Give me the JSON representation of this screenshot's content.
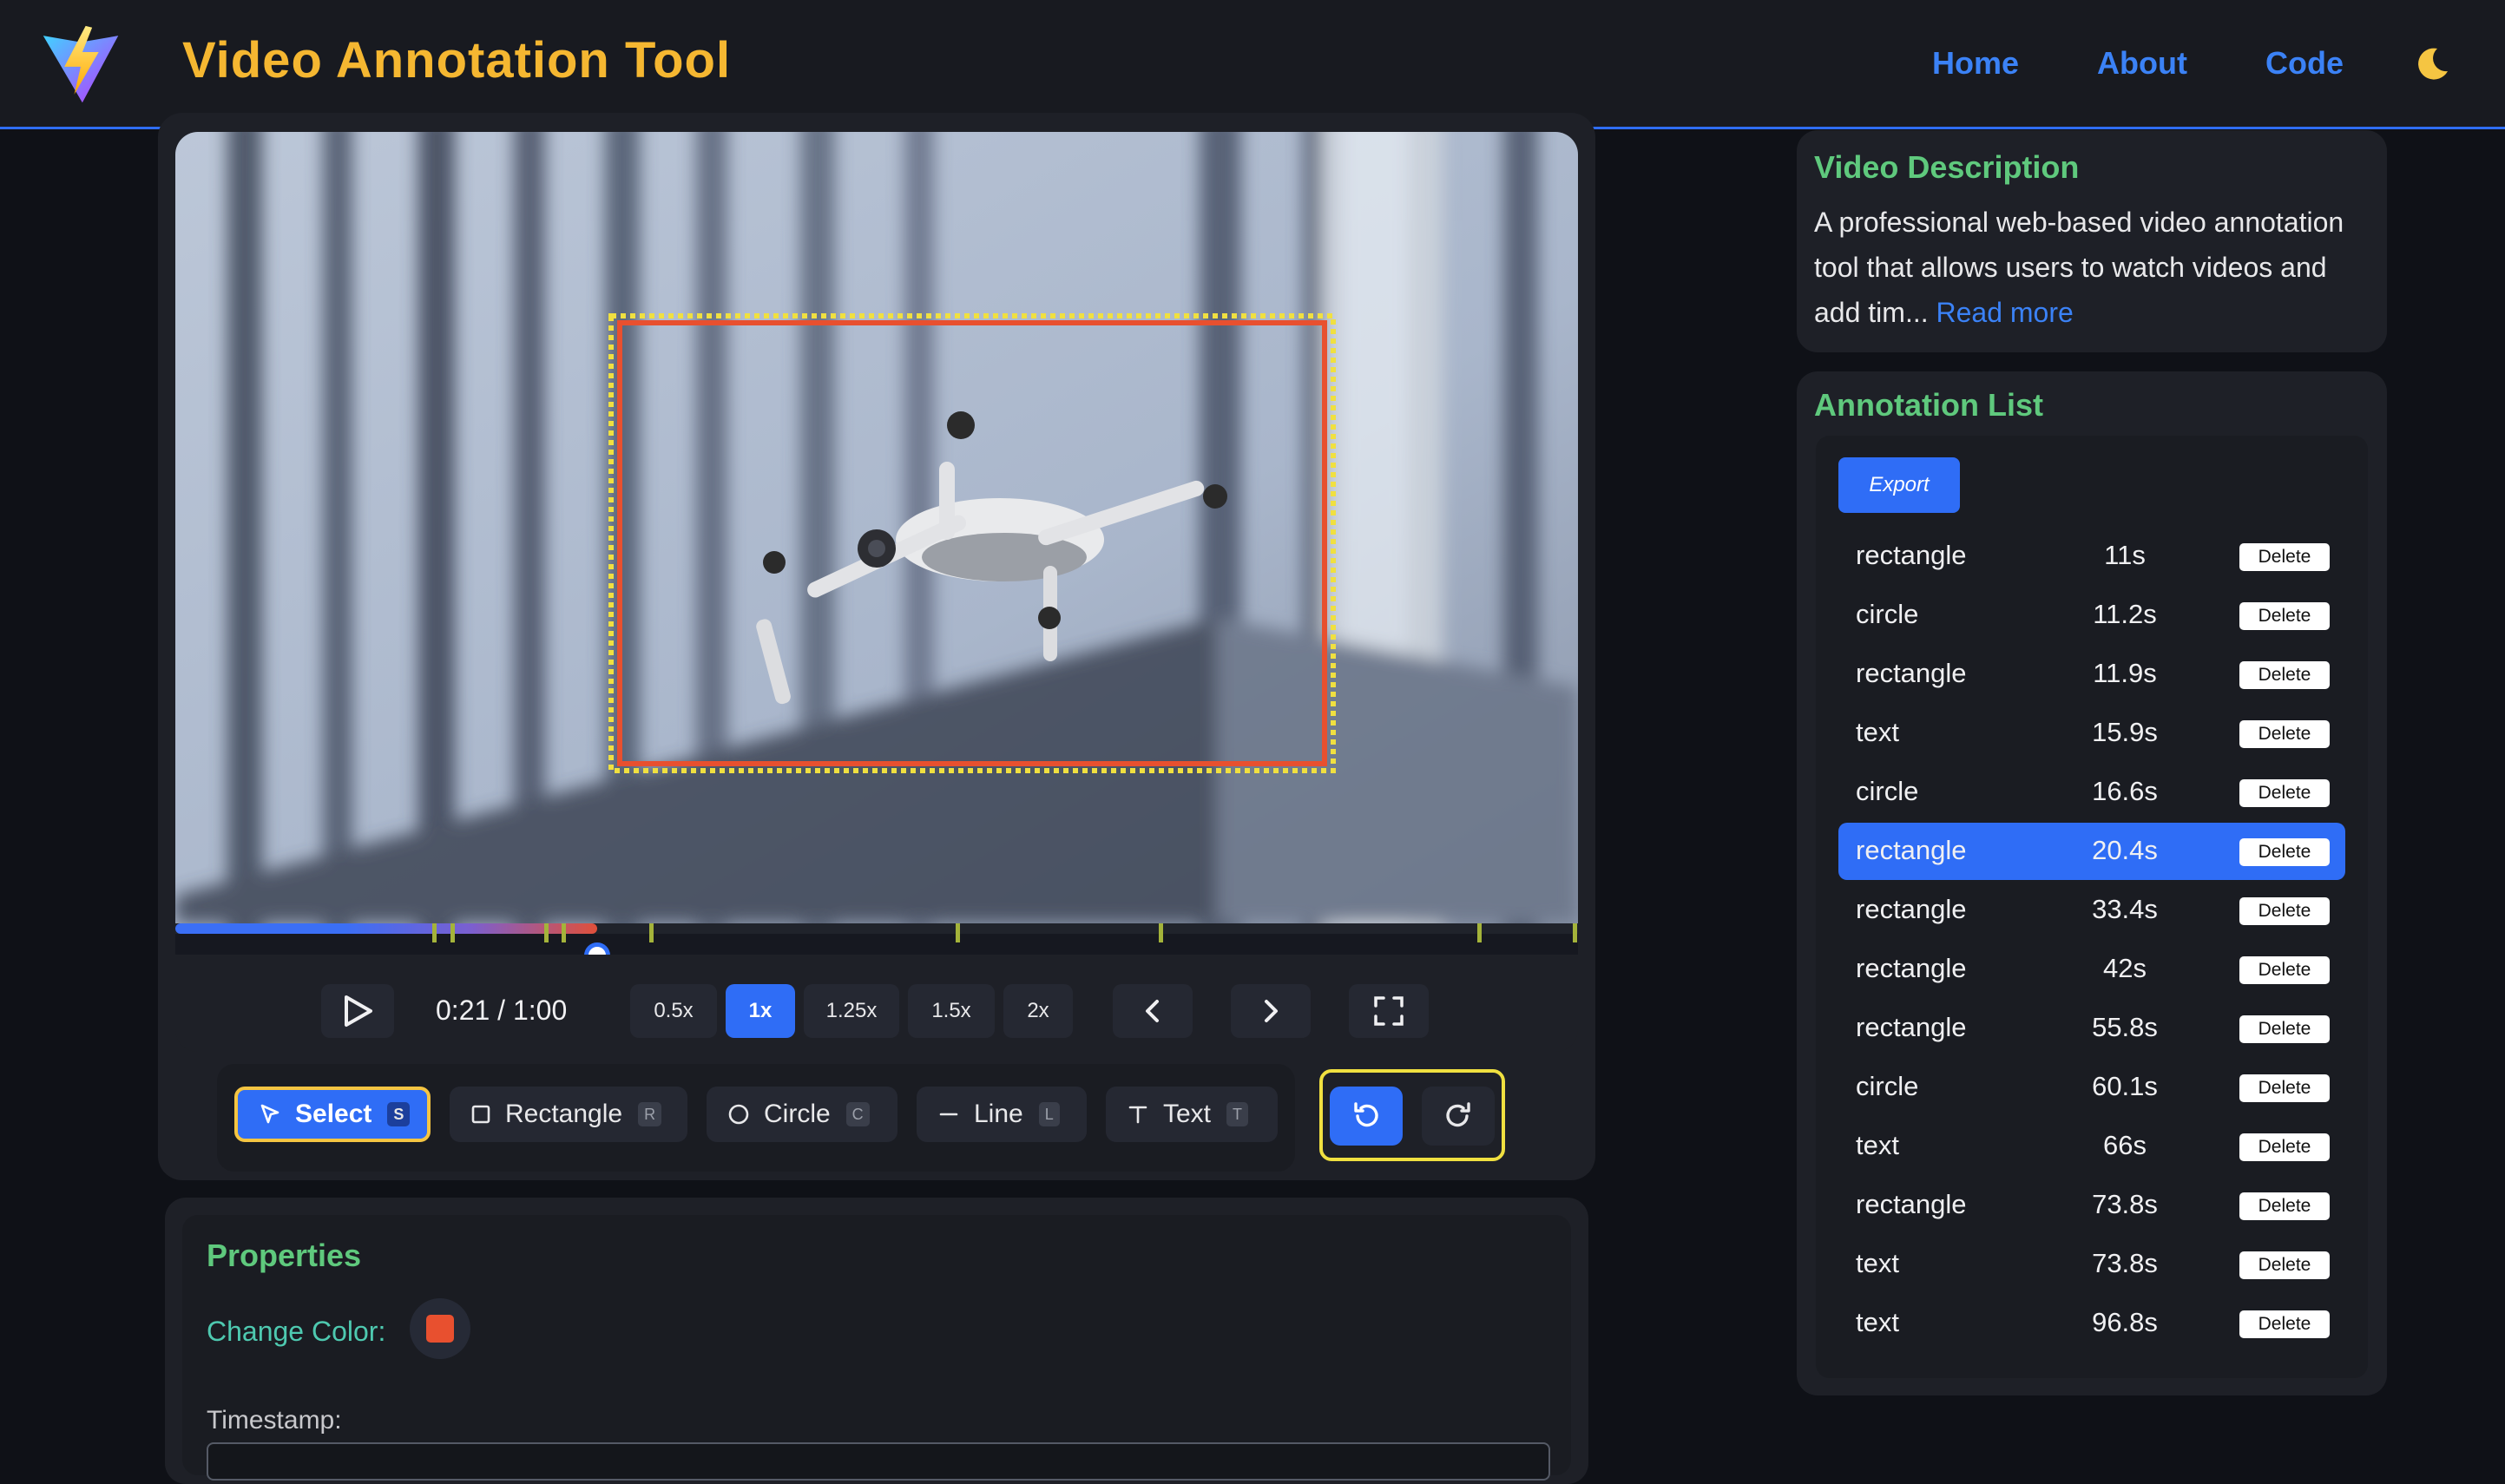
{
  "header": {
    "title": "Video Annotation Tool",
    "nav": [
      "Home",
      "About",
      "Code"
    ],
    "theme_icon": "moon-icon"
  },
  "player": {
    "time": "0:21 / 1:00",
    "progress_fraction": 0.35,
    "marker_fractions": [
      0.185,
      0.198,
      0.265,
      0.277,
      0.34,
      0.558,
      0.703,
      0.93,
      0.998
    ],
    "speeds": [
      "0.5x",
      "1x",
      "1.25x",
      "1.5x",
      "2x"
    ],
    "active_speed": "1x",
    "buttons": {
      "play": "play-icon",
      "prev": "chevron-left-icon",
      "next": "chevron-right-icon",
      "fullscreen": "fullscreen-icon"
    }
  },
  "tools": [
    {
      "label": "Select",
      "key": "S",
      "icon": "cursor-icon"
    },
    {
      "label": "Rectangle",
      "key": "R",
      "icon": "square-icon"
    },
    {
      "label": "Circle",
      "key": "C",
      "icon": "circle-icon"
    },
    {
      "label": "Line",
      "key": "L",
      "icon": "line-icon"
    },
    {
      "label": "Text",
      "key": "T",
      "icon": "text-icon"
    }
  ],
  "selected_tool": "Select",
  "history": {
    "undo_icon": "undo-icon",
    "redo_icon": "redo-icon"
  },
  "properties": {
    "title": "Properties",
    "change_color_label": "Change Color:",
    "color": "#e8502f",
    "timestamp_label": "Timestamp:"
  },
  "description": {
    "title": "Video Description",
    "text": "A professional web-based video annotation tool that allows users to watch videos and add tim...",
    "read_more": "Read more"
  },
  "annotation_list": {
    "title": "Annotation List",
    "export_label": "Export",
    "delete_label": "Delete",
    "highlighted_index": 5,
    "items": [
      {
        "type": "rectangle",
        "time": "11s"
      },
      {
        "type": "circle",
        "time": "11.2s"
      },
      {
        "type": "rectangle",
        "time": "11.9s"
      },
      {
        "type": "text",
        "time": "15.9s"
      },
      {
        "type": "circle",
        "time": "16.6s"
      },
      {
        "type": "rectangle",
        "time": "20.4s"
      },
      {
        "type": "rectangle",
        "time": "33.4s"
      },
      {
        "type": "rectangle",
        "time": "42s"
      },
      {
        "type": "rectangle",
        "time": "55.8s"
      },
      {
        "type": "circle",
        "time": "60.1s"
      },
      {
        "type": "text",
        "time": "66s"
      },
      {
        "type": "rectangle",
        "time": "73.8s"
      },
      {
        "type": "text",
        "time": "73.8s"
      },
      {
        "type": "text",
        "time": "96.8s"
      }
    ]
  },
  "colors": {
    "accent": "#2f6df6",
    "title": "#f5b731",
    "section": "#5fc97d",
    "selection": "#f5c542",
    "annotation": "#e8502f"
  }
}
